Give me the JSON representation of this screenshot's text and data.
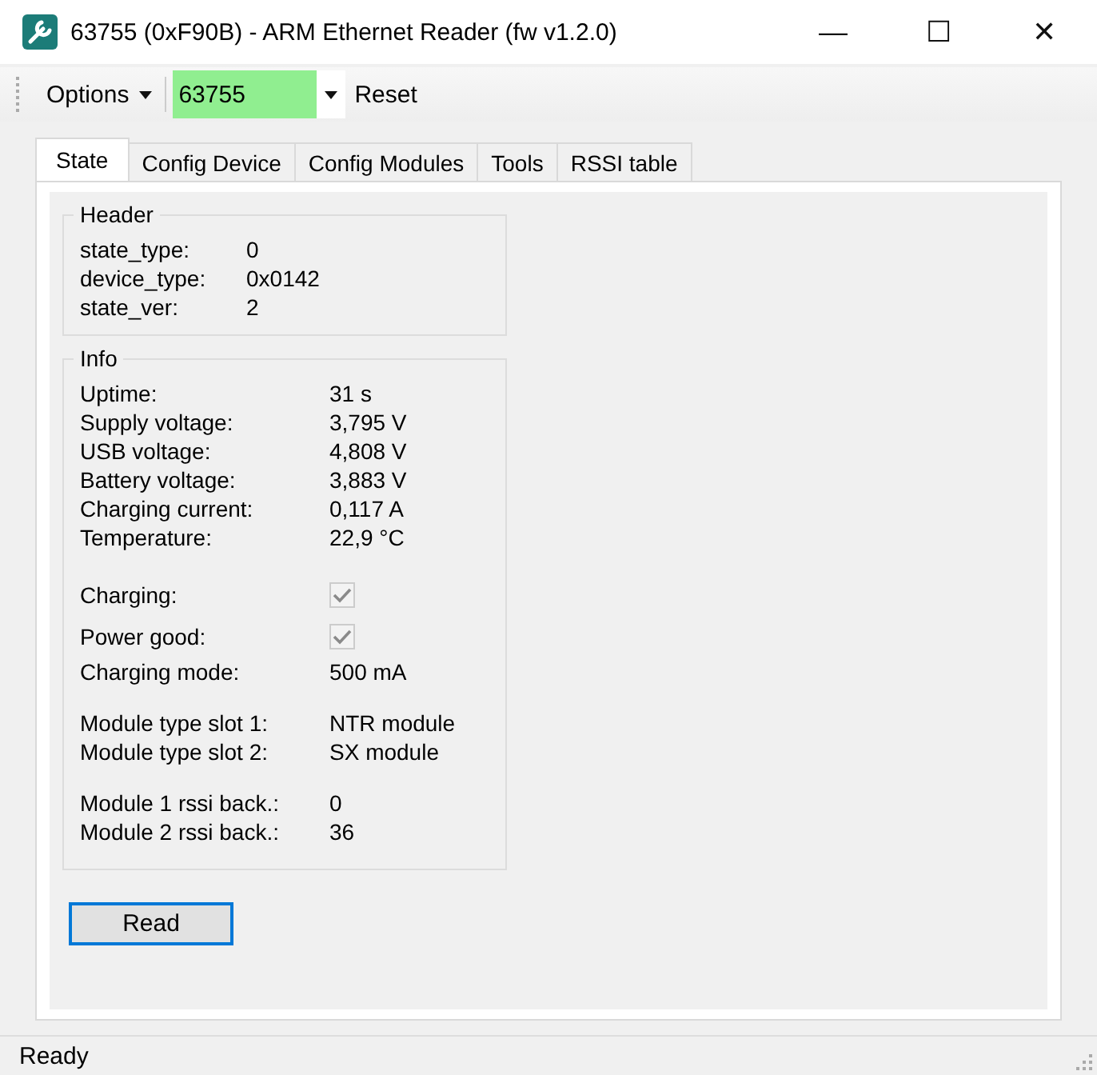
{
  "window": {
    "title": "63755 (0xF90B) - ARM Ethernet Reader (fw v1.2.0)",
    "controls": [
      "—",
      "☐",
      "✕"
    ]
  },
  "toolbar": {
    "options": "Options",
    "device": "63755",
    "reset": "Reset"
  },
  "tabs": [
    {
      "label": "State",
      "selected": true
    },
    {
      "label": "Config Device",
      "selected": false
    },
    {
      "label": "Config Modules",
      "selected": false
    },
    {
      "label": "Tools",
      "selected": false
    },
    {
      "label": "RSSI table",
      "selected": false
    }
  ],
  "header_group": {
    "title": "Header",
    "rows": [
      {
        "label": "state_type:",
        "value": "0"
      },
      {
        "label": "device_type:",
        "value": "0x0142"
      },
      {
        "label": "state_ver:",
        "value": "2"
      }
    ]
  },
  "info_group": {
    "title": "Info",
    "sections": [
      [
        {
          "kind": "value",
          "label": "Uptime:",
          "value": "31 s"
        },
        {
          "kind": "value",
          "label": "Supply voltage:",
          "value": "3,795 V"
        },
        {
          "kind": "value",
          "label": "USB voltage:",
          "value": "4,808 V"
        },
        {
          "kind": "value",
          "label": "Battery voltage:",
          "value": "3,883 V"
        },
        {
          "kind": "value",
          "label": "Charging current:",
          "value": "0,117 A"
        },
        {
          "kind": "value",
          "label": "Temperature:",
          "value": "22,9 °C"
        }
      ],
      [
        {
          "kind": "checkbox",
          "label": "Charging:",
          "checked": true,
          "disabled": true
        },
        {
          "kind": "checkbox",
          "label": "Power good:",
          "checked": true,
          "disabled": true
        },
        {
          "kind": "value",
          "label": "Charging mode:",
          "value": "500 mA"
        }
      ],
      [
        {
          "kind": "value",
          "label": "Module type slot 1:",
          "value": "NTR module"
        },
        {
          "kind": "value",
          "label": "Module type slot 2:",
          "value": "SX module"
        }
      ],
      [
        {
          "kind": "value",
          "label": "Module 1 rssi back.:",
          "value": "0"
        },
        {
          "kind": "value",
          "label": "Module 2 rssi back.:",
          "value": "36"
        }
      ]
    ]
  },
  "read_button": "Read",
  "status_bar": "Ready"
}
